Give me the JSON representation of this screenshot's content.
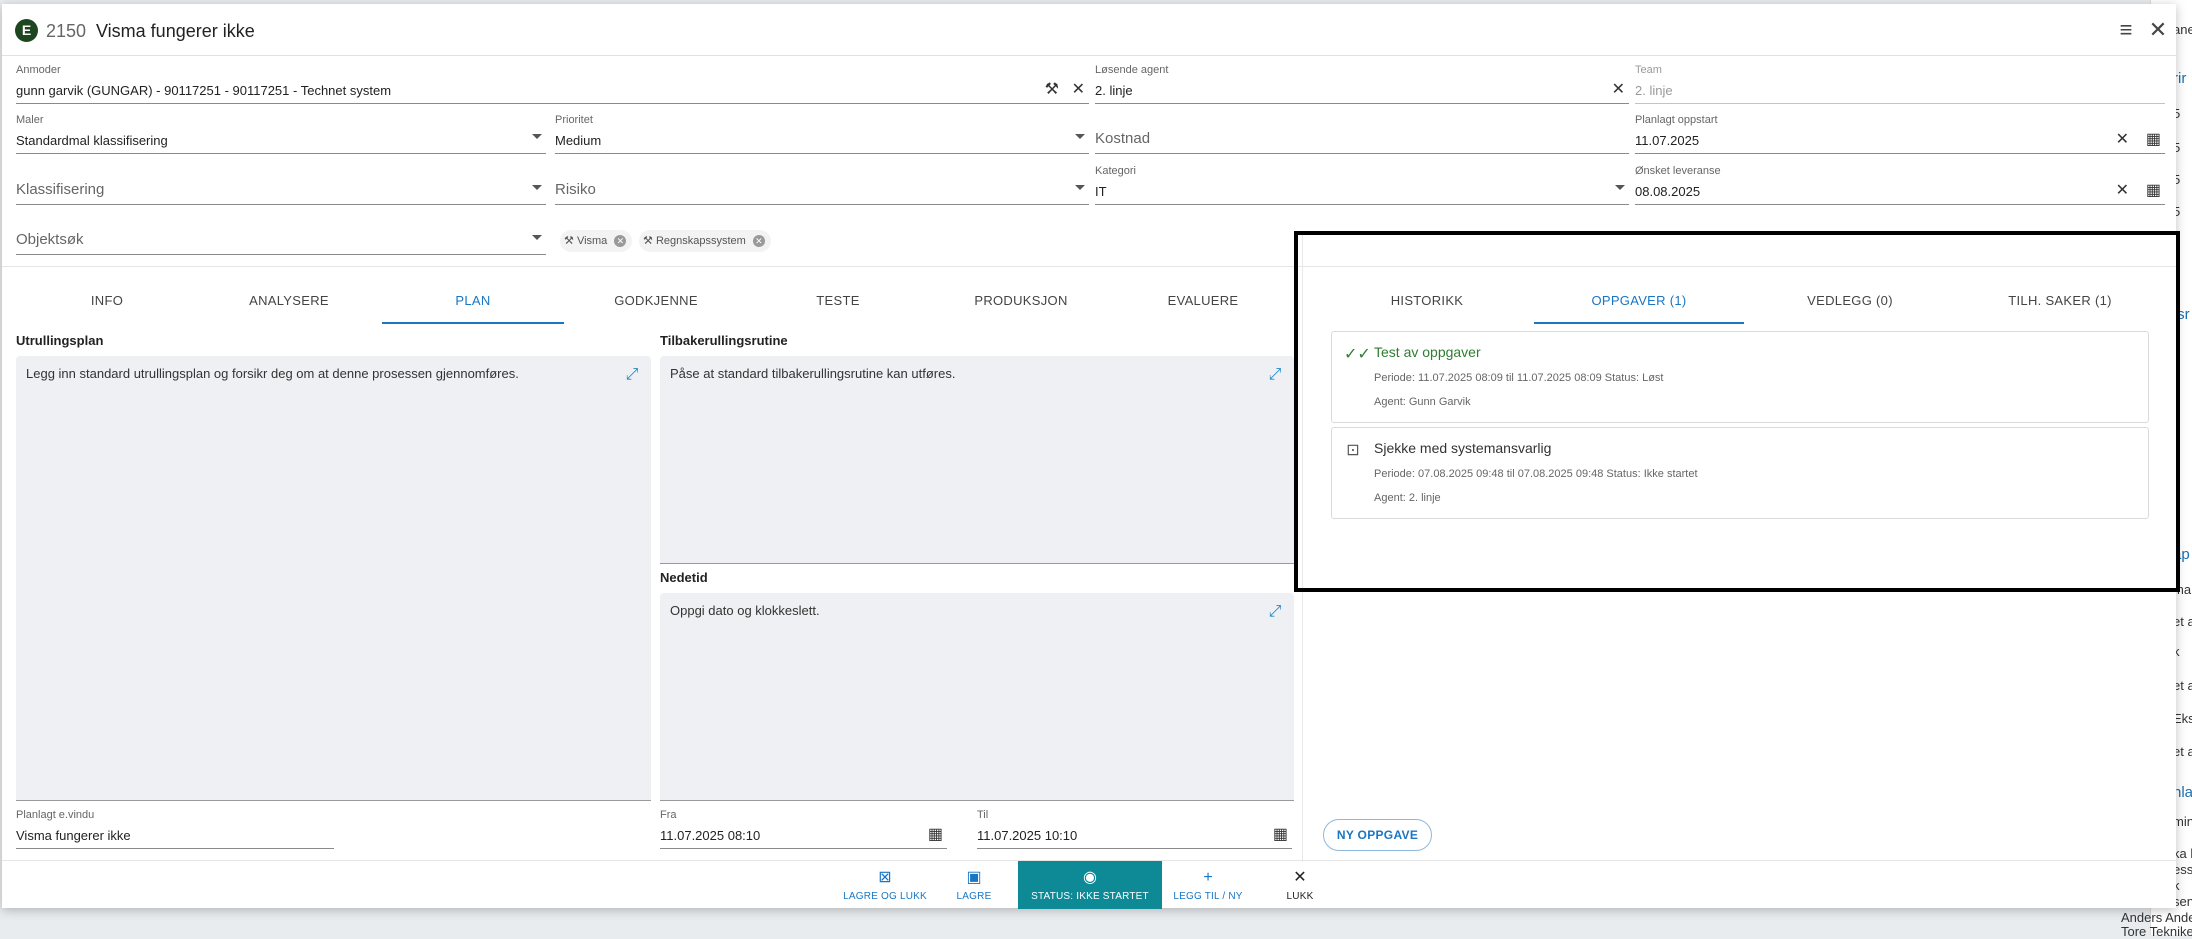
{
  "background": {
    "items": [
      "ane",
      "rir",
      "5",
      "5",
      "5",
      "5",
      "5",
      "tsr",
      "åp",
      "ma",
      "et av",
      "k",
      "et av",
      "Eks",
      "et av",
      "nla",
      "min",
      "ka ko",
      "ess",
      "k",
      "sen",
      "Anders Anders",
      "Tore Tekniker"
    ]
  },
  "header": {
    "badge": "E",
    "ticket_number": "2150",
    "title": "Visma fungerer ikke"
  },
  "fields": {
    "anmoder": {
      "label": "Anmoder",
      "value": "gunn garvik (GUNGAR) - 90117251 - 90117251 - Technet system"
    },
    "losende_agent": {
      "label": "Løsende agent",
      "value": "2. linje"
    },
    "team": {
      "label": "Team",
      "value": "2. linje"
    },
    "maler": {
      "label": "Maler",
      "value": "Standardmal klassifisering"
    },
    "prioritet": {
      "label": "Prioritet",
      "value": "Medium"
    },
    "kostnad": {
      "placeholder": "Kostnad"
    },
    "planlagt_oppstart": {
      "label": "Planlagt oppstart",
      "value": "11.07.2025"
    },
    "klassifisering": {
      "placeholder": "Klassifisering"
    },
    "risiko": {
      "placeholder": "Risiko"
    },
    "kategori": {
      "label": "Kategori",
      "value": "IT"
    },
    "onsket_leveranse": {
      "label": "Ønsket leveranse",
      "value": "08.08.2025"
    },
    "objektsok": {
      "placeholder": "Objektsøk"
    }
  },
  "chips": [
    "Visma",
    "Regnskapssystem"
  ],
  "left_tabs": [
    "INFO",
    "ANALYSERE",
    "PLAN",
    "GODKJENNE",
    "TESTE",
    "PRODUKSJON",
    "EVALUERE"
  ],
  "plan": {
    "utrullingsplan_title": "Utrullingsplan",
    "utrullingsplan_text": "Legg inn standard utrullingsplan og forsikr deg om at denne prosessen gjennomføres.",
    "tilbakerulling_title": "Tilbakerullingsrutine",
    "tilbakerulling_text": "Påse at standard tilbakerullingsrutine kan utføres.",
    "nedetid_title": "Nedetid",
    "nedetid_text": "Oppgi dato og klokkeslett.",
    "planlagt_evindu_label": "Planlagt e.vindu",
    "planlagt_evindu_value": "Visma fungerer ikke",
    "fra_label": "Fra",
    "fra_value": "11.07.2025 08:10",
    "til_label": "Til",
    "til_value": "11.07.2025 10:10"
  },
  "right_tabs": [
    "HISTORIKK",
    "OPPGAVER (1)",
    "VEDLEGG (0)",
    "TILH. SAKER (1)"
  ],
  "tasks": [
    {
      "name": "Test av oppgaver",
      "meta": "Periode: 11.07.2025 08:09  til  11.07.2025 08:09    Status: Løst",
      "agent": "Agent: Gunn Garvik",
      "color": "#2e7d32"
    },
    {
      "name": "Sjekke med systemansvarlig",
      "meta": "Periode: 07.08.2025 09:48  til  07.08.2025 09:48    Status: Ikke startet",
      "agent": "Agent: 2. linje",
      "color": "#333333"
    }
  ],
  "ny_oppgave": "NY OPPGAVE",
  "footer": {
    "lagre_og_lukk": "LAGRE OG LUKK",
    "lagre": "LAGRE",
    "status": "STATUS: IKKE STARTET",
    "legg_til_ny": "LEGG TIL / NY",
    "lukk": "LUKK"
  },
  "colors": {
    "accent": "#1976c4",
    "status_bg": "#0e8a96",
    "badge_bg": "#1e4620",
    "done_green": "#2e7d32"
  }
}
